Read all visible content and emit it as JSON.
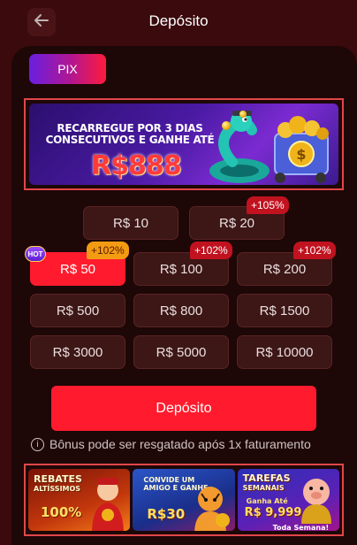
{
  "header": {
    "title": "Depósito",
    "back_icon": "arrow-left-icon"
  },
  "payment_tabs": [
    {
      "label": "PIX",
      "selected": true
    }
  ],
  "banner": {
    "text_line1": "RECARREGUE POR 3 DIAS",
    "text_line2": "CONSECUTIVOS E GANHE ATÉ",
    "amount": "R$888"
  },
  "amounts": [
    {
      "label": "R$ 10",
      "badge": ""
    },
    {
      "label": "R$ 20",
      "badge": "+105%"
    },
    {
      "label": "R$ 50",
      "badge": "+102%",
      "selected": true,
      "hot": "HOT"
    },
    {
      "label": "R$ 100",
      "badge": "+102%"
    },
    {
      "label": "R$ 200",
      "badge": "+102%"
    },
    {
      "label": "R$ 500",
      "badge": ""
    },
    {
      "label": "R$ 800",
      "badge": ""
    },
    {
      "label": "R$ 1500",
      "badge": ""
    },
    {
      "label": "R$ 3000",
      "badge": ""
    },
    {
      "label": "R$ 5000",
      "badge": ""
    },
    {
      "label": "R$ 10000",
      "badge": ""
    }
  ],
  "deposit_button": "Depósito",
  "note": {
    "icon": "info-icon",
    "text": "Bônus pode ser resgatado após 1x faturamento"
  },
  "promos": [
    {
      "title_line1": "REBATES",
      "title_line2": "ALTÍSSIMOS",
      "value": "100%"
    },
    {
      "title_line1": "CONVIDE UM",
      "title_line2": "AMIGO E GANHE",
      "value": "R$30"
    },
    {
      "title_line1": "TAREFAS",
      "title_line2": "SEMANAIS",
      "sub1": "Ganha Até",
      "value": "R$ 9,999",
      "sub2": "Toda Semana!"
    }
  ],
  "colors": {
    "background": "#3a0a0c",
    "panel": "#1e0707",
    "accent": "#ff1b2d",
    "button": "#3d1616",
    "highlight_border": "#e0474a"
  }
}
